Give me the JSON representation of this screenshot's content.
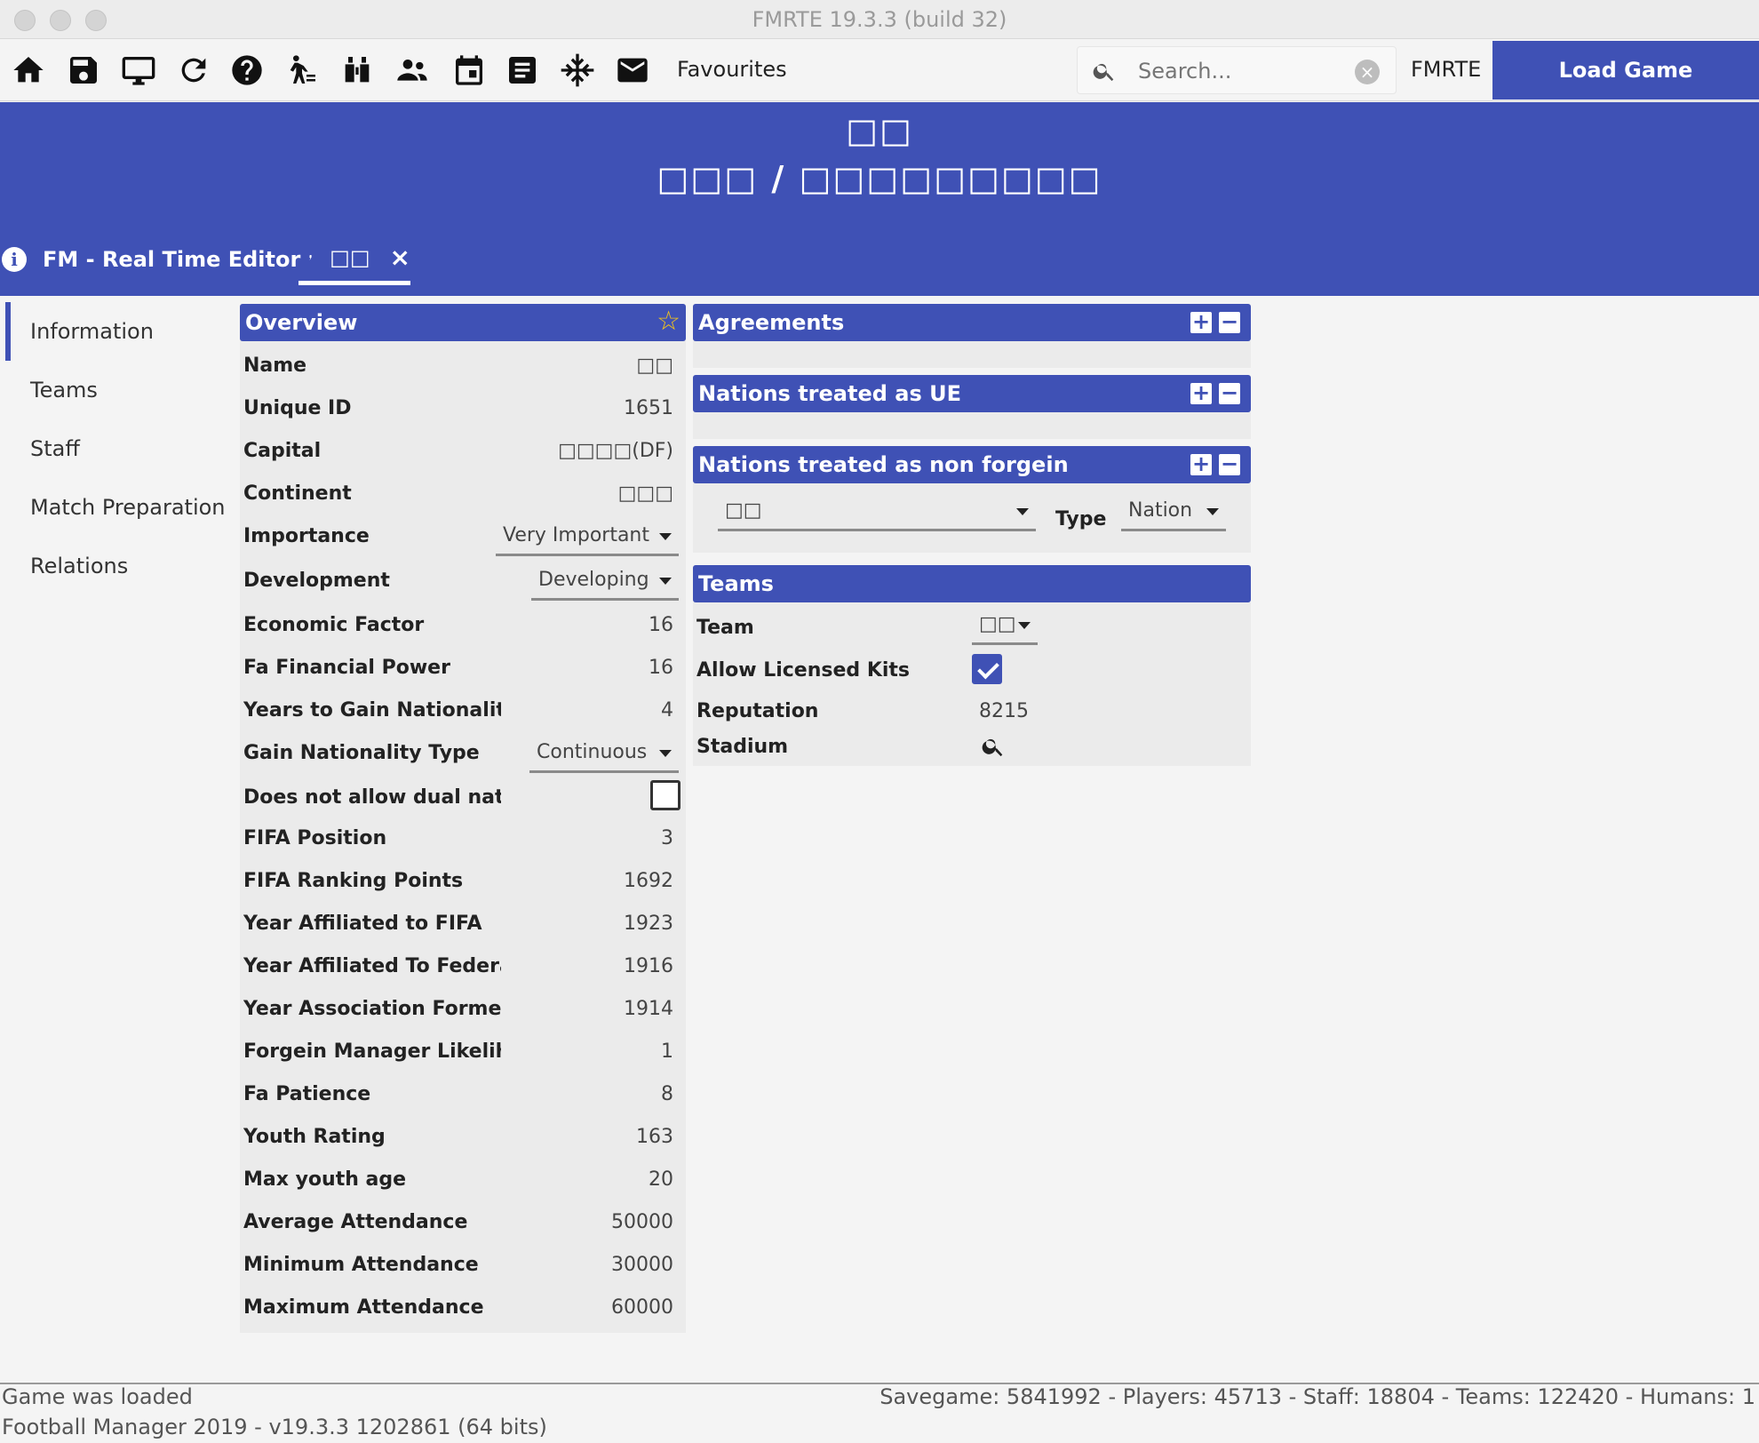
{
  "window": {
    "title": "FMRTE 19.3.3 (build 32)"
  },
  "toolbar": {
    "icons": [
      "home-icon",
      "save-icon",
      "monitor-icon",
      "refresh-icon",
      "help-icon",
      "transfer-icon",
      "binoculars-icon",
      "people-icon",
      "calendar-icon",
      "list-icon",
      "settings-icon",
      "mail-icon"
    ],
    "favourites_label": "Favourites",
    "search_placeholder": "Search...",
    "fmrte_label": "FMRTE",
    "load_game_label": "Load Game"
  },
  "header": {
    "title": "□□",
    "subtitle": "□□□ / □□□□□□□□□",
    "tabs": [
      {
        "label": "FM - Real Time Editor"
      },
      {
        "label": "□□",
        "close": "×"
      }
    ]
  },
  "sidebar": {
    "items": [
      {
        "label": "Information"
      },
      {
        "label": "Teams"
      },
      {
        "label": "Staff"
      },
      {
        "label": "Match Preparation"
      },
      {
        "label": "Relations"
      }
    ]
  },
  "overview": {
    "title": "Overview",
    "rows": [
      {
        "label": "Name",
        "value": "□□"
      },
      {
        "label": "Unique ID",
        "value": "1651"
      },
      {
        "label": "Capital",
        "value": "□□□□(DF)"
      },
      {
        "label": "Continent",
        "value": "□□□"
      },
      {
        "label": "Importance",
        "value": "Very Important"
      },
      {
        "label": "Development",
        "value": "Developing"
      },
      {
        "label": "Economic Factor",
        "value": "16"
      },
      {
        "label": "Fa Financial Power",
        "value": "16"
      },
      {
        "label": "Years to Gain Nationality",
        "value": "4"
      },
      {
        "label": "Gain Nationality Type",
        "value": "Continuous"
      },
      {
        "label": "Does not allow dual nationality",
        "value": ""
      },
      {
        "label": "FIFA Position",
        "value": "3"
      },
      {
        "label": "FIFA Ranking Points",
        "value": "1692"
      },
      {
        "label": "Year Affiliated to FIFA",
        "value": "1923"
      },
      {
        "label": "Year Affiliated To Federation",
        "value": "1916"
      },
      {
        "label": "Year Association Formed",
        "value": "1914"
      },
      {
        "label": "Forgein Manager Likelihood",
        "value": "1"
      },
      {
        "label": "Fa Patience",
        "value": "8"
      },
      {
        "label": "Youth Rating",
        "value": "163"
      },
      {
        "label": "Max youth age",
        "value": "20"
      },
      {
        "label": "Average Attendance",
        "value": "50000"
      },
      {
        "label": "Minimum Attendance",
        "value": "30000"
      },
      {
        "label": "Maximum Attendance",
        "value": "60000"
      }
    ]
  },
  "agreements": {
    "title": "Agreements"
  },
  "nations_ue": {
    "title": "Nations treated as UE"
  },
  "nations_nonforeign": {
    "title": "Nations treated as non forgein",
    "nation_value": "□□",
    "type_label": "Type",
    "type_value": "Nation"
  },
  "teams": {
    "title": "Teams",
    "team_label": "Team",
    "team_value": "□□",
    "licensed_label": "Allow Licensed Kits",
    "reputation_label": "Reputation",
    "reputation_value": "8215",
    "stadium_label": "Stadium"
  },
  "status": {
    "line1": "Game was loaded",
    "line2": "Football Manager 2019 - v19.3.3 1202861  (64 bits)",
    "stats": "Savegame: 5841992 - Players: 45713 - Staff: 18804 - Teams: 122420 - Humans: 1"
  }
}
